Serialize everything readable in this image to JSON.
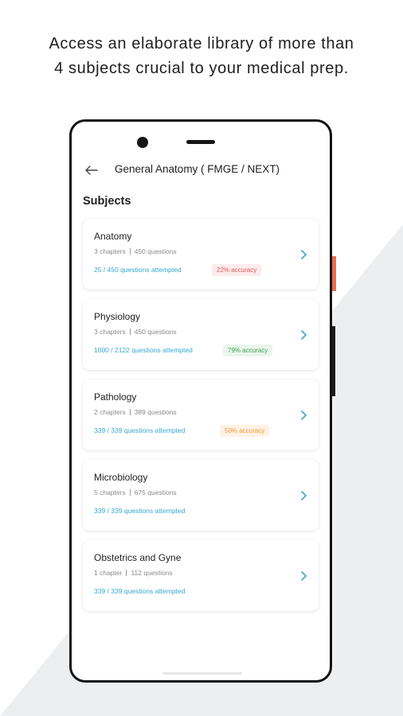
{
  "headline": {
    "line1": "Access an elaborate library of more than",
    "line2": "4 subjects crucial to your medical prep."
  },
  "appbar": {
    "back_icon": "arrow-left-icon",
    "title": "General Anatomy ( FMGE / NEXT)"
  },
  "section_title": "Subjects",
  "subjects": [
    {
      "name": "Anatomy",
      "chapters": "3 chapters",
      "questions": "450 questions",
      "progress": "25 / 450 questions attempted",
      "accuracy": "22% accuracy"
    },
    {
      "name": "Physiology",
      "chapters": "3 chapters",
      "questions": "450 questions",
      "progress": "1000 / 2122 questions attempted",
      "accuracy": "79% accuracy"
    },
    {
      "name": "Pathology",
      "chapters": "2 chapters",
      "questions": "389 questions",
      "progress": "339 / 339 questions attempted",
      "accuracy": "50% accuracy"
    },
    {
      "name": "Microbiology",
      "chapters": "5 chapters",
      "questions": "675 questions",
      "progress": "339 / 339 questions attempted"
    },
    {
      "name": "Obstetrics and Gyne",
      "chapters": "1 chapter",
      "questions": "112 questions",
      "progress": "339 / 339 questions attempted"
    }
  ],
  "colors": {
    "progress_text": "#35a7cf",
    "accuracy_low": "#e25a5a",
    "accuracy_high": "#3ea456",
    "accuracy_mid": "#f0963a",
    "chevron": "#35a7cf",
    "background_shape": "#eceef0",
    "accent": "#e66e52"
  },
  "icons": {
    "chevron": "chevron-right-icon"
  }
}
